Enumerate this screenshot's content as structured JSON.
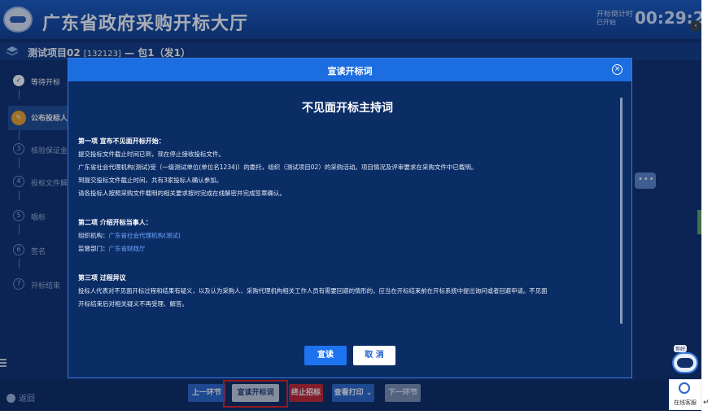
{
  "header": {
    "title": "广东省政府采购开标大厅",
    "clock_label": "开标倒计时",
    "clock_sub": "已开始",
    "clock": "00:29:2"
  },
  "project": {
    "name_bold": "测试项目02",
    "code": "[132123]",
    "package": "— 包1（发1）"
  },
  "steps": [
    {
      "num": "✓",
      "label": "等待开标"
    },
    {
      "num": "",
      "label": "公布投标人"
    },
    {
      "num": "3",
      "label": "核验保证金"
    },
    {
      "num": "4",
      "label": "投标文件解"
    },
    {
      "num": "5",
      "label": "唱标"
    },
    {
      "num": "6",
      "label": "签名"
    },
    {
      "num": "7",
      "label": "开标结束"
    }
  ],
  "modal": {
    "title": "宣读开标词",
    "doc_title": "不见面开标主持词",
    "sections": [
      {
        "heading": "第一项 宣布不见面开标开始：",
        "lines": [
          "提交投标文件截止时间已到，现在停止接收投标文件。",
          "广东省社会代理机构(测试)受（一级测试单位(单位名1234)）的委托，组织（测试项目02）的采购活动。项目情况及评审要求在采购文件中已载明。",
          "到提交投标文件截止时间，共有3家投标人确认参加。",
          "请各投标人按照采购文件载明的相关要求按时完成在线解密并完成签章确认。"
        ]
      },
      {
        "heading": "第二项 介绍开标当事人：",
        "agency_label": "组织机构：",
        "agency_value": "广东省社会代理机构(测试)",
        "supervisor_label": "监督部门：",
        "supervisor_value": "广东省财政厅"
      },
      {
        "heading": "第三项 过程异议",
        "lines": [
          "投标人代表对不见面开标过程和结果有疑义，以及认为采购人、采购代理机构相关工作人员有需要回避的情形的，应当在开标结束前在开标系统中提出询问或者回避申请。不见面",
          "开标结束后对相关疑义不再受理、解答。"
        ]
      }
    ],
    "confirm_label": "宣读",
    "cancel_label": "取 消"
  },
  "bottom": {
    "back_label": "返回",
    "prev_label": "上一环节",
    "read_label": "宣读开标词",
    "stop_label": "终止招标",
    "print_label": "查看打印",
    "next_label": "下一环节"
  },
  "service": {
    "tag": "你好",
    "label": "在线客服"
  },
  "colors": {
    "accent": "#1b6de0",
    "active_step": "#f0a325",
    "stop": "#c4252d",
    "highlight": "#e0201b"
  }
}
